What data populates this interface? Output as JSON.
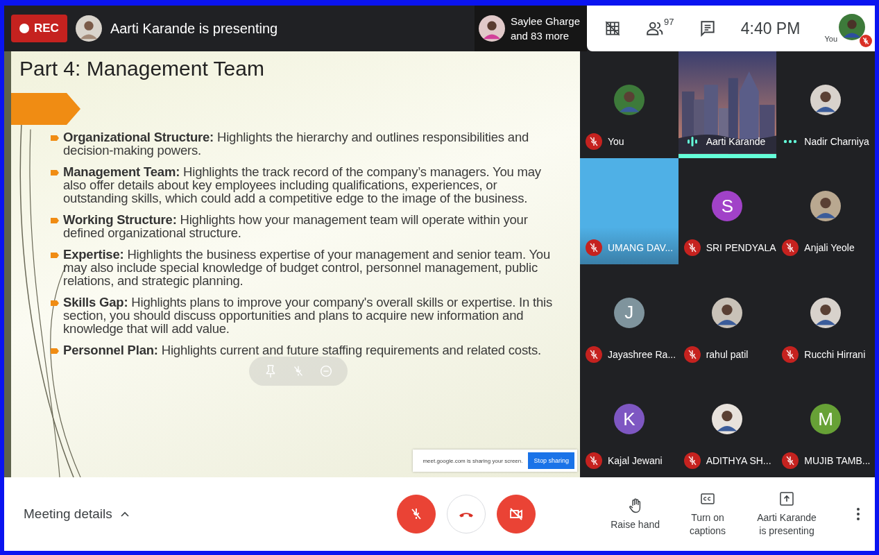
{
  "top_bar": {
    "rec": "REC",
    "presenter": "Aarti Karande is presenting",
    "others": [
      "Saylee Gharge",
      "and 83 more"
    ],
    "participant_count": "97",
    "time": "4:40 PM",
    "self_label": "You",
    "self_muted": true
  },
  "slide": {
    "title": "Part 4: Management Team",
    "bullets": [
      "**Organizational Structure:** Highlights the hierarchy and outlines responsibilities and decision-making powers.",
      "**Management Team:** Highlights the track record of the company’s managers. You may also offer details about key employees including qualifications, experiences, or outstanding skills, which could add a competitive edge to the image of the business.",
      "**Working Structure:** Highlights how your management team will operate within your defined organizational structure.",
      "**Expertise:** Highlights the business expertise of your management and senior team. You may also include special knowledge of budget control, personnel management, public relations, and strategic planning.",
      "**Skills Gap:** Highlights plans to improve your company's overall skills or expertise. In this section, you should discuss opportunities and plans to acquire new information and knowledge that will add value.",
      "**Personnel Plan:** Highlights current and future staffing requirements and related costs."
    ],
    "share_notice": {
      "text": "meet.google.com is sharing your screen.",
      "button": "Stop sharing"
    }
  },
  "tiles": [
    {
      "name": "You",
      "indicator": {
        "kind": "muted"
      },
      "active": false
    },
    {
      "name": "Aarti Karande",
      "kind": "video",
      "indicator": {
        "kind": "speaking"
      },
      "active": true
    },
    {
      "name": "Nadir Charniya",
      "indicator": {
        "kind": "options"
      },
      "active": false
    },
    {
      "name": "UMANG DAV...",
      "kind": "blank",
      "indicator": {
        "kind": "muted"
      },
      "active": false
    },
    {
      "name": "SRI PENDYALA",
      "kind": "initial",
      "initial": "S",
      "color": "#a142c8",
      "indicator": {
        "kind": "muted"
      },
      "active": false
    },
    {
      "name": "Anjali Yeole",
      "indicator": {
        "kind": "muted"
      },
      "active": false
    },
    {
      "name": "Jayashree Ra...",
      "kind": "initial",
      "initial": "J",
      "color": "#7f949d",
      "indicator": {
        "kind": "muted"
      },
      "active": false
    },
    {
      "name": "rahul patil",
      "indicator": {
        "kind": "muted"
      },
      "active": false
    },
    {
      "name": "Rucchi Hirrani",
      "indicator": {
        "kind": "muted"
      },
      "active": false
    },
    {
      "name": "Kajal Jewani",
      "kind": "initial",
      "initial": "K",
      "color": "#7e57c2",
      "indicator": {
        "kind": "muted"
      },
      "active": false
    },
    {
      "name": "ADITHYA SH...",
      "indicator": {
        "kind": "muted"
      },
      "active": false
    },
    {
      "name": "MUJIB TAMB...",
      "kind": "initial",
      "initial": "M",
      "color": "#67a136",
      "indicator": {
        "kind": "muted"
      },
      "active": false
    }
  ],
  "bottom_bar": {
    "details": "Meeting details",
    "mic_on": false,
    "camera_on": false,
    "actions": [
      {
        "kind": "hand",
        "label": "Raise hand"
      },
      {
        "kind": "captions",
        "label": "Turn on captions"
      },
      {
        "kind": "present",
        "label": "Aarti Karande is presenting"
      }
    ]
  }
}
